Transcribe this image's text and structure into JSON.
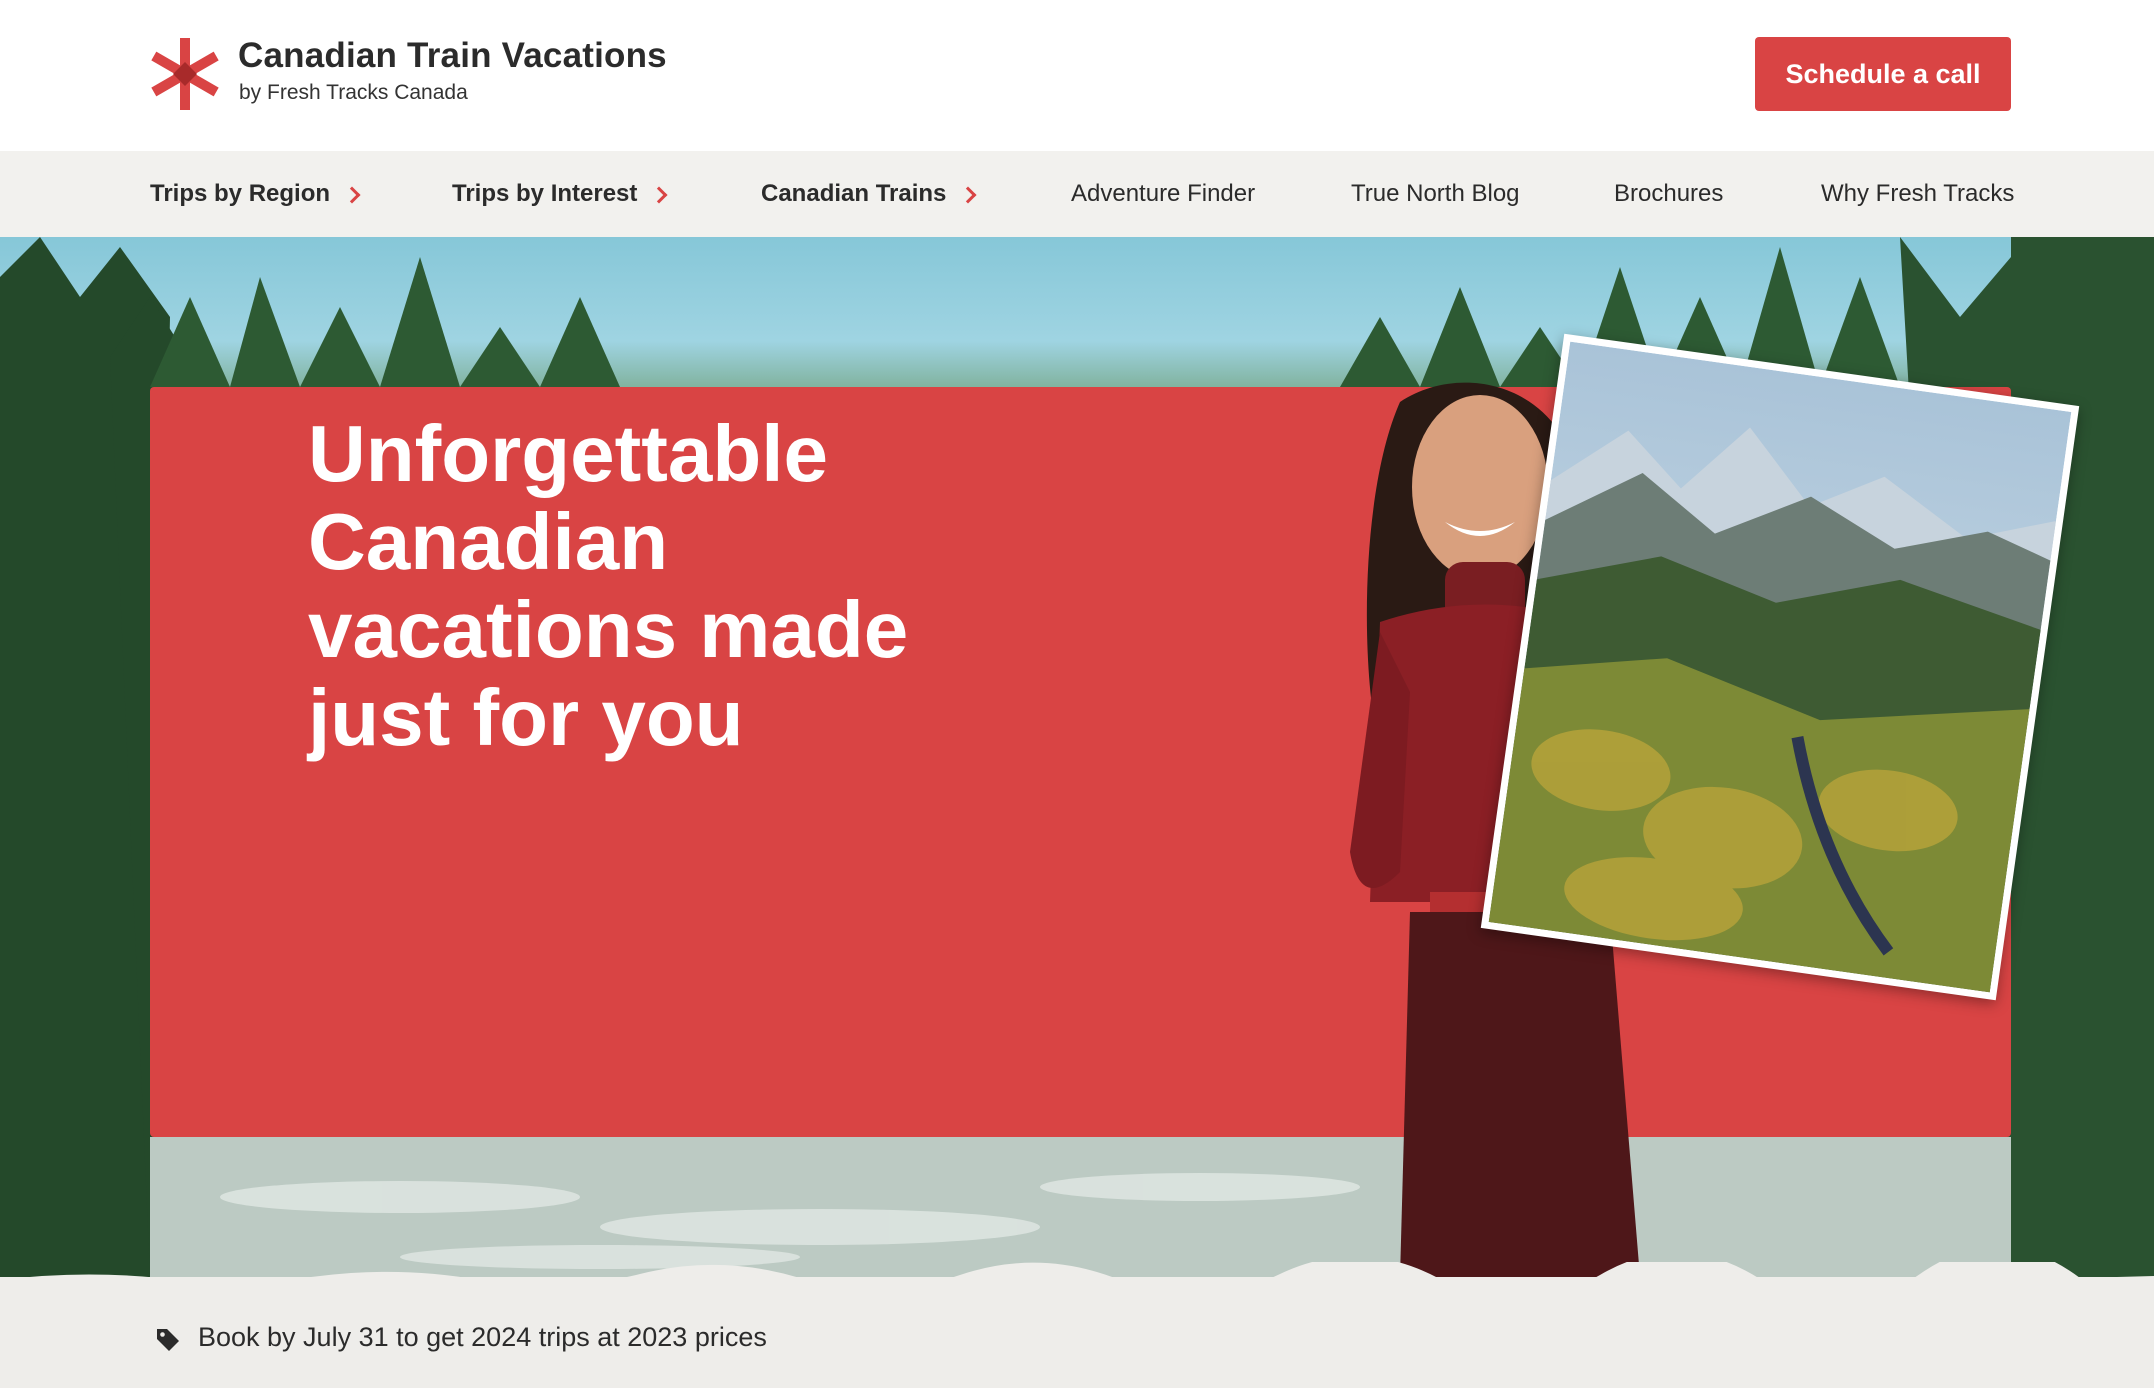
{
  "brand": {
    "title": "Canadian Train Vacations",
    "subtitle": "by Fresh Tracks Canada",
    "logo_icon": "red-asterisk-logo-icon",
    "accent_color": "#d94444"
  },
  "header": {
    "cta_label": "Schedule a call"
  },
  "nav": {
    "items": [
      {
        "label": "Trips by Region",
        "has_chevron": true
      },
      {
        "label": "Trips by Interest",
        "has_chevron": true
      },
      {
        "label": "Canadian Trains",
        "has_chevron": true
      },
      {
        "label": "Adventure Finder",
        "has_chevron": false
      },
      {
        "label": "True North Blog",
        "has_chevron": false
      },
      {
        "label": "Brochures",
        "has_chevron": false
      },
      {
        "label": "Why Fresh Tracks",
        "has_chevron": false
      }
    ]
  },
  "hero": {
    "title": "Unforgettable Canadian vacations made just for you"
  },
  "promo": {
    "icon": "tag-icon",
    "text": "Book by July 31 to get 2024 trips at 2023 prices"
  }
}
